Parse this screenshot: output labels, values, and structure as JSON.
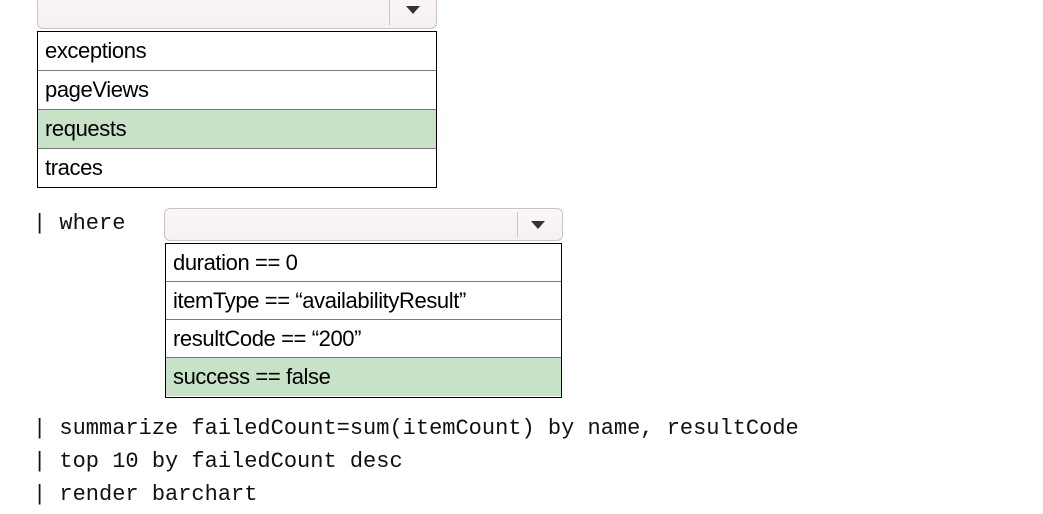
{
  "dropdown_table": {
    "current_value": "",
    "options": [
      "exceptions",
      "pageViews",
      "requests",
      "traces"
    ],
    "selected": "requests"
  },
  "where_clause": {
    "prefix": "| where ",
    "current_value": "",
    "options": [
      "duration == 0",
      "itemType == “availabilityResult”",
      "resultCode == “200”",
      "success == false"
    ],
    "selected": "success == false"
  },
  "code_lines": [
    "| summarize failedCount=sum(itemCount) by name, resultCode",
    "| top 10 by failedCount desc",
    "| render barchart"
  ],
  "icons": {
    "dropdown_arrow": "chevron-down-icon"
  },
  "colors": {
    "selected_option_bg": "#c7e2c7",
    "select_border": "#c9c3c3",
    "select_bg": "#f8f2f2"
  }
}
